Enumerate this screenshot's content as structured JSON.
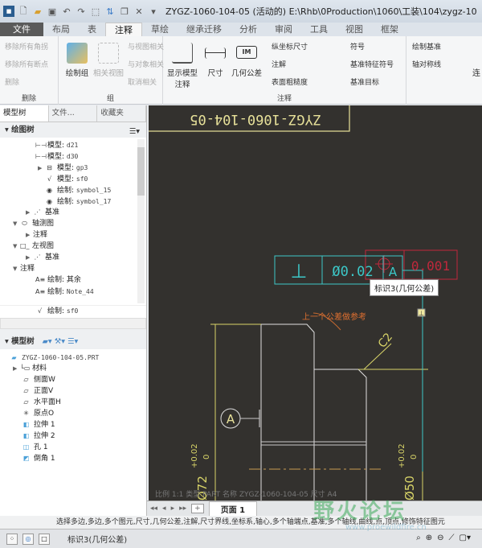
{
  "titlebar": {
    "title": "ZYGZ-1060-104-05 (活动的) E:\\Rhb\\0Production\\1060\\工装\\104\\zygz-10"
  },
  "tabs": [
    "文件",
    "布局",
    "表",
    "注释",
    "草绘",
    "继承迁移",
    "分析",
    "审阅",
    "工具",
    "视图",
    "框架"
  ],
  "active_tab": "注释",
  "ribbon": {
    "delete_group": {
      "items": [
        "移除所有角拐",
        "移除所有断点",
        "删除"
      ],
      "label": "删除"
    },
    "group_group": {
      "draw_group": "绘制组",
      "related_view": "相关视图",
      "items": [
        "与视图相关",
        "与对象相关",
        "取消相关"
      ],
      "label": "组"
    },
    "annotation_group": {
      "show_model_annotations": "显示模型注释",
      "dimension": "尺寸",
      "gtol": "几何公差",
      "items": [
        "纵坐标尺寸",
        "注解",
        "表面粗糙度",
        "符号",
        "基准特征符号",
        "基准目标",
        "绘制基准",
        "轴对称线"
      ],
      "label": "注释"
    },
    "extra": "连"
  },
  "left_panel": {
    "tabs": [
      "模型树",
      "文件...",
      "收藏夹"
    ],
    "drawing_tree_header": "绘图树",
    "drawing_tree": [
      {
        "kind": "模型:",
        "name": "d21",
        "icon": "dimension-icon"
      },
      {
        "kind": "模型:",
        "name": "d30",
        "icon": "dimension-icon"
      },
      {
        "kind": "模型:",
        "name": "gp3",
        "icon": "gtol-icon"
      },
      {
        "kind": "模型:",
        "name": "sf0",
        "icon": "surface-finish-icon"
      },
      {
        "kind": "绘制:",
        "name": "symbol_15",
        "icon": "symbol-icon"
      },
      {
        "kind": "绘制:",
        "name": "symbol_17",
        "icon": "symbol-icon"
      },
      {
        "label": "基准"
      },
      {
        "label": "轴测图"
      },
      {
        "label": "注释"
      },
      {
        "label": "左视图"
      },
      {
        "label": "基准"
      },
      {
        "label": "注释"
      },
      {
        "kind": "绘制:",
        "name": "其余"
      },
      {
        "kind": "绘制:",
        "name": "Note_44"
      },
      {
        "kind": "绘制:",
        "name": "sf0"
      }
    ],
    "model_tree_header": "模型树",
    "model_tree": [
      "ZYGZ-1060-104-05.PRT",
      "材料",
      "侧面W",
      "正面V",
      "水平面H",
      "原点O",
      "拉伸 1",
      "拉伸 2",
      "孔 1",
      "倒角 1"
    ]
  },
  "drawing": {
    "title_block_text": "ZYGZ-1060-104-05",
    "fcf": {
      "symbol": "⊥",
      "tolerance": "Ø0.02",
      "datum": "A"
    },
    "ref_fcf": {
      "tolerance": "0.001"
    },
    "tooltip": "标识3(几何公差)",
    "note": "上一个公差做参考",
    "chamfer": "C2",
    "datum_label": "A",
    "dim1": {
      "value": "Ø72",
      "upper": "+0.02",
      "lower": "0"
    },
    "dim2": {
      "value": "Ø50",
      "upper": "+0.02",
      "lower": "0"
    },
    "sheet_info": "比例 1:1   类型 PART   名称 ZYGZ-1060-104-05   尺寸 A4"
  },
  "sheetbar": {
    "page": "页面 1",
    "add": "+"
  },
  "statusline": "选择多边,多边,多个图元,尺寸,几何公差,注解,尺寸界线,坐标系,轴心,多个轴端点,基准,多个轴线,曲线,点,顶点,修饰特征图元",
  "bottombar": {
    "selection": "标识3(几何公差)"
  },
  "watermark": {
    "text": "野火论坛",
    "url": "www.proewildfire.cn"
  }
}
